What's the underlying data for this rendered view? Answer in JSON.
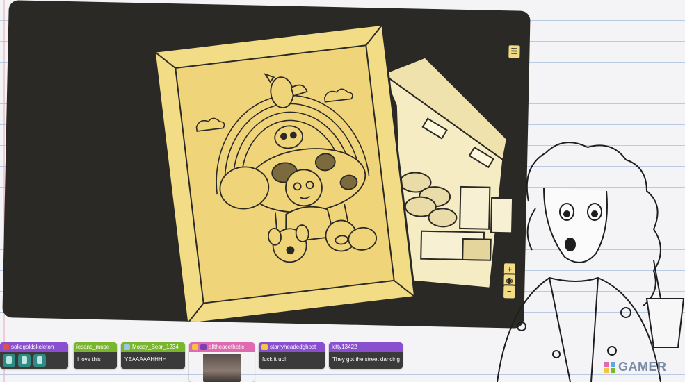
{
  "colors": {
    "game_bg": "#2a2925",
    "frame": "#f2dc86",
    "frame_dark": "#d8b85a",
    "room": "#f5ecc4",
    "purple": "#8a4fcf",
    "green": "#7ab52e",
    "pink": "#e06ab0"
  },
  "hud": {
    "menu_icon": "menu-icon",
    "zoom_in_label": "+",
    "zoom_out_label": "−"
  },
  "chat": [
    {
      "user": "solidgoldskeleton",
      "message": "",
      "emotes": 3,
      "color": "#8a4fcf"
    },
    {
      "user": "iesans_muse",
      "message": "I love this",
      "emotes": 0,
      "color": "#7ab52e"
    },
    {
      "user": "Mossy_Bear_1234",
      "message": "YEAAAAAHHHH",
      "emotes": 0,
      "color": "#7ab52e"
    },
    {
      "user": "alltheacethetic",
      "message": "",
      "emotes": 0,
      "color": "#e06ab0"
    },
    {
      "user": "starryheadedghost",
      "message": "fuck it up!!",
      "emotes": 0,
      "color": "#8a4fcf"
    },
    {
      "user": "kitty13422",
      "message": "They got the street dancing",
      "emotes": 0,
      "color": "#8a4fcf"
    }
  ],
  "watermark": {
    "text": "GAMER"
  }
}
